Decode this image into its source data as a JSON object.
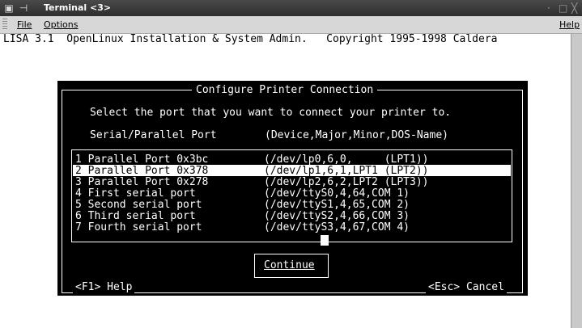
{
  "window": {
    "title": "Terminal <3>",
    "icon_left": "terminal-menu-icon",
    "pin_icon": "pin-icon",
    "minimize_symbol": "·",
    "maximize_symbol": "□",
    "close_symbol": "╳"
  },
  "menubar": {
    "file": "File",
    "options": "Options",
    "help": "Help"
  },
  "terminal": {
    "header": "LISA 3.1  OpenLinux Installation & System Admin.   Copyright 1995-1998 Caldera",
    "dialog": {
      "title": "Configure Printer Connection",
      "prompt": "Select the port that you want to connect your printer to.",
      "col_port": "Serial/Parallel Port",
      "col_device": "(Device,Major,Minor,DOS-Name)",
      "items": [
        {
          "label": "1 Parallel Port 0x3bc    ",
          "device": "(/dev/lp0,6,0,     (LPT1))"
        },
        {
          "label": "2 Parallel Port 0x378    ",
          "device": "(/dev/lp1,6,1,LPT1 (LPT2))"
        },
        {
          "label": "3 Parallel Port 0x278    ",
          "device": "(/dev/lp2,6,2,LPT2 (LPT3))"
        },
        {
          "label": "4 First serial port      ",
          "device": "(/dev/ttyS0,4,64,COM 1)"
        },
        {
          "label": "5 Second serial port     ",
          "device": "(/dev/ttyS1,4,65,COM 2)"
        },
        {
          "label": "6 Third serial port      ",
          "device": "(/dev/ttyS2,4,66,COM 3)"
        },
        {
          "label": "7 Fourth serial port     ",
          "device": "(/dev/ttyS3,4,67,COM 4)"
        }
      ],
      "selected_index": 1,
      "continue_button": "Continue",
      "footer_left": "<F1> Help",
      "footer_right": "<Esc> Cancel"
    }
  },
  "colors": {
    "dialog_bg": "#000000",
    "dialog_fg": "#ffffff",
    "terminal_bg": "#ffffff"
  }
}
